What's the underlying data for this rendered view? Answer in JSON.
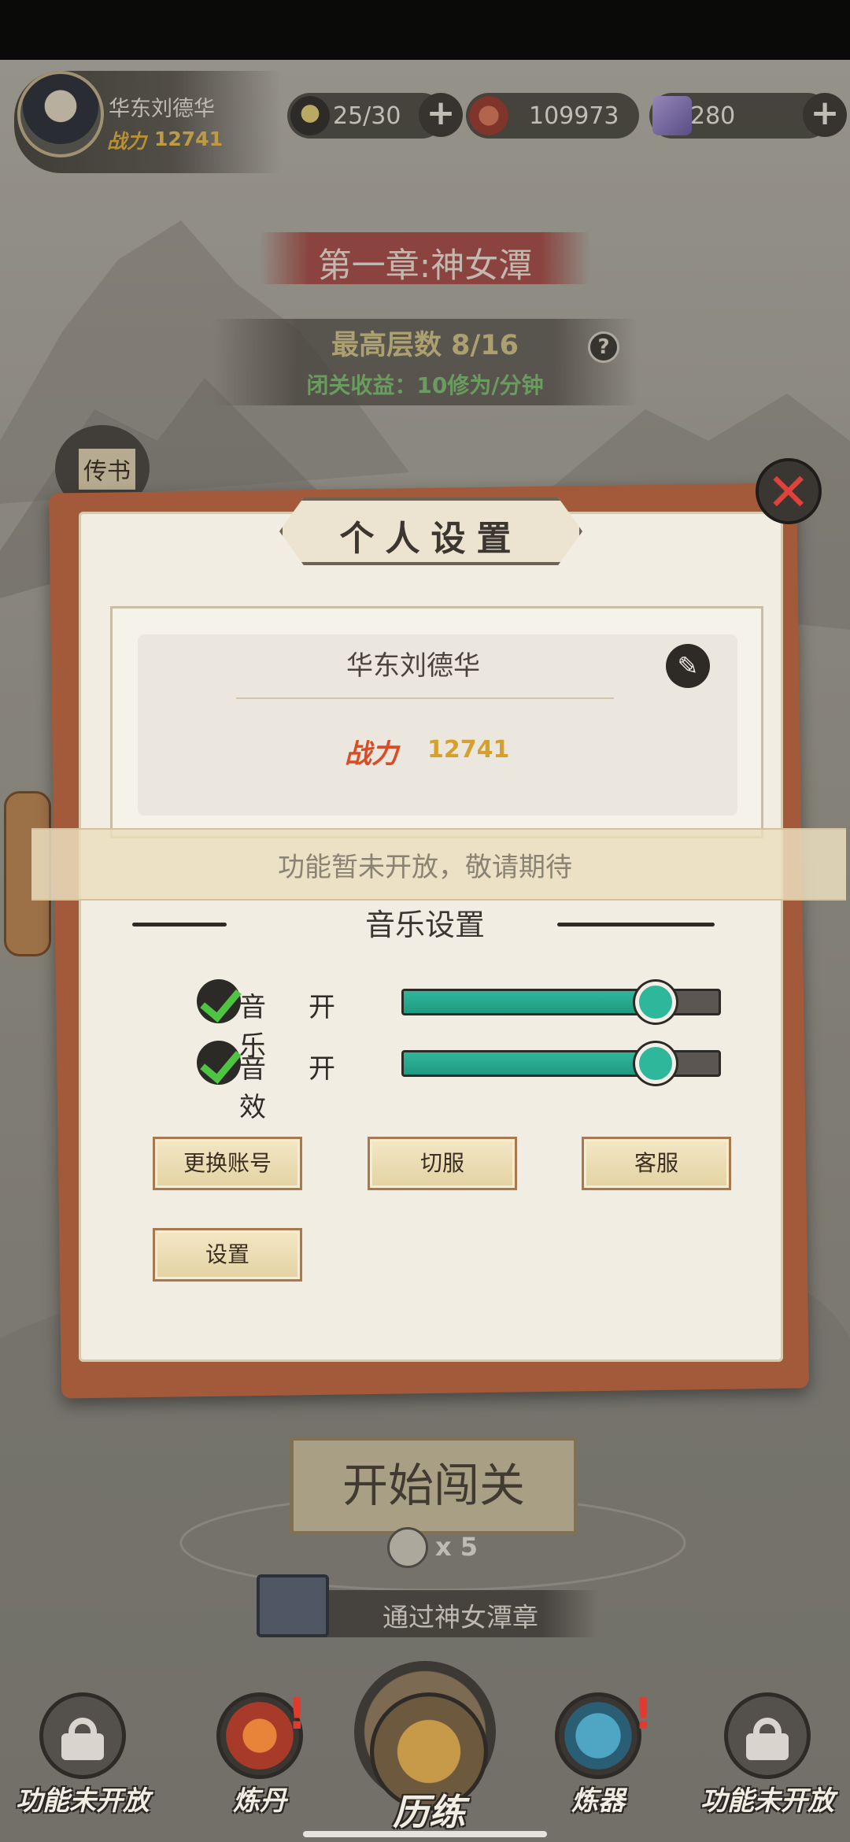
{
  "hud": {
    "player_name": "华东刘德华",
    "power_badge": "战力",
    "power_value": "12741",
    "stamina": "25/30",
    "currency": "109973",
    "gems": "280"
  },
  "chapter": {
    "title": "第一章:神女潭",
    "max_floor": "最高层数 8/16",
    "idle_income": "闭关收益：10修为/分钟"
  },
  "side": {
    "letter_label": "传书"
  },
  "modal": {
    "title": "个人设置",
    "profile_name": "华东刘德华",
    "power_badge": "战力",
    "power_value": "12741",
    "notice": "功能暂未开放，敬请期待",
    "music_section_title": "音乐设置",
    "toggles": [
      {
        "label": "音乐",
        "state": "开",
        "level": 0.8
      },
      {
        "label": "音效",
        "state": "开",
        "level": 0.8
      }
    ],
    "buttons": {
      "switch_account": "更换账号",
      "switch_server": "切服",
      "customer_service": "客服",
      "settings": "设置"
    }
  },
  "stage": {
    "start_button": "开始闯关",
    "cost": "x 5",
    "reward_text": "通过神女潭章"
  },
  "nav": {
    "items": [
      {
        "label": "功能未开放"
      },
      {
        "label": "炼丹"
      },
      {
        "label": "历练"
      },
      {
        "label": "炼器"
      },
      {
        "label": "功能未开放"
      }
    ]
  },
  "colors": {
    "accent_teal": "#2fb79b",
    "check_green": "#4fc443",
    "close_red": "#e0413b",
    "banner_red": "#aa3c37"
  }
}
